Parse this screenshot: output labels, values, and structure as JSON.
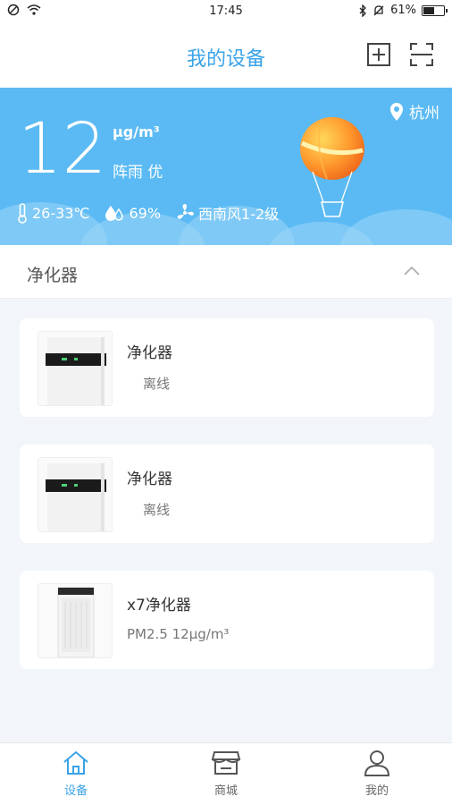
{
  "status_bar": {
    "time": "17:45",
    "battery": "61%",
    "battery_level": 0.61
  },
  "header": {
    "title": "我的设备",
    "add_icon": "plus-square-icon",
    "scan_icon": "scan-frame-icon"
  },
  "weather": {
    "aqi_value": "12",
    "aqi_unit": "μg/m³",
    "condition": "阵雨 优",
    "temperature": "26-33℃",
    "humidity": "69%",
    "wind": "西南风1-2级",
    "city": "杭州"
  },
  "section": {
    "title": "净化器"
  },
  "devices": [
    {
      "name": "净化器",
      "status": "离线"
    },
    {
      "name": "净化器",
      "status": "离线"
    },
    {
      "name": "x7净化器",
      "status": "PM2.5 12μg/m³"
    }
  ],
  "tabs": [
    {
      "label": "设备",
      "icon": "home-icon",
      "active": true
    },
    {
      "label": "商城",
      "icon": "shop-icon",
      "active": false
    },
    {
      "label": "我的",
      "icon": "user-icon",
      "active": false
    }
  ],
  "colors": {
    "accent": "#3aa3e8",
    "weather_bg": "#5bbaf3"
  }
}
